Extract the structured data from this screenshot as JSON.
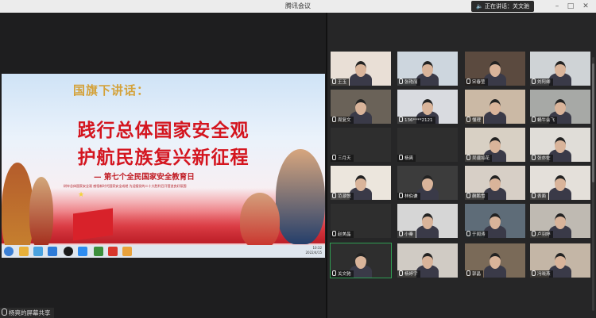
{
  "window": {
    "title": "腾讯会议"
  },
  "speaking": {
    "text": "正在讲话：关文驰"
  },
  "controls": {
    "min": "–",
    "max": "□",
    "close": "✕"
  },
  "slide": {
    "header": "国旗下讲话：",
    "title_line1": "践行总体国家安全观",
    "title_line2": "护航民族复兴新征程",
    "subtitle": "— 第七个全民国家安全教育日",
    "tagline": "树牢总体国家安全观  感悟新时代国家安全成就  为迎接党的二十大胜利召开营造良好氛围"
  },
  "taskbar": {
    "clock_time": "10:32",
    "clock_date": "2022/4/15"
  },
  "sharer": {
    "label": "杨爽的屏幕共享"
  },
  "participants": [
    {
      "name": "王玉"
    },
    {
      "name": "张艳丽"
    },
    {
      "name": "宋春莹"
    },
    {
      "name": "刘阿卿"
    },
    {
      "name": "周复文"
    },
    {
      "name": "136****2121"
    },
    {
      "name": "懂理"
    },
    {
      "name": "蜗牛会飞"
    },
    {
      "name": "三月天"
    },
    {
      "name": "杨爽"
    },
    {
      "name": "吴疆如花"
    },
    {
      "name": "张亦佐"
    },
    {
      "name": "范潮悦"
    },
    {
      "name": "林伯谦"
    },
    {
      "name": "蒯鹏雪"
    },
    {
      "name": "表面"
    },
    {
      "name": "赵美晶"
    },
    {
      "name": "小秦"
    },
    {
      "name": "于闻涛"
    },
    {
      "name": "卢羽婷"
    },
    {
      "name": "关文驰"
    },
    {
      "name": "杨婷宇"
    },
    {
      "name": "郭晶"
    },
    {
      "name": "冯晓燕"
    }
  ]
}
